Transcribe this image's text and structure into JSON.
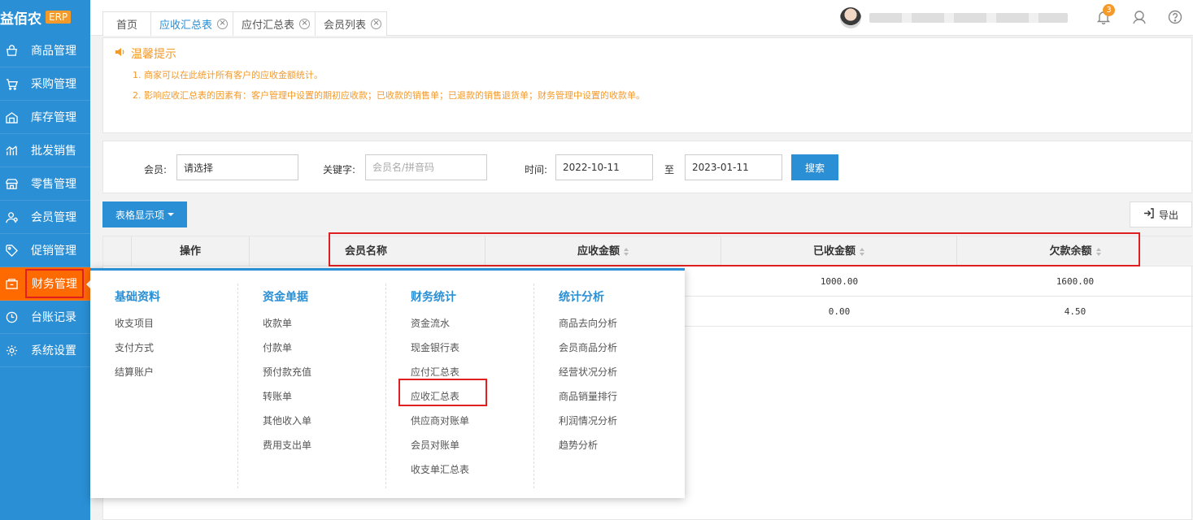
{
  "app": {
    "logo_text": "益佰农",
    "logo_badge": "ERP"
  },
  "sidebar": {
    "items": [
      {
        "label": "商品管理",
        "icon": "bag-icon"
      },
      {
        "label": "采购管理",
        "icon": "cart-icon"
      },
      {
        "label": "库存管理",
        "icon": "warehouse-icon"
      },
      {
        "label": "批发销售",
        "icon": "chart-icon"
      },
      {
        "label": "零售管理",
        "icon": "store-icon"
      },
      {
        "label": "会员管理",
        "icon": "member-icon"
      },
      {
        "label": "促销管理",
        "icon": "tag-icon"
      },
      {
        "label": "财务管理",
        "icon": "finance-icon",
        "active": true
      },
      {
        "label": "台账记录",
        "icon": "record-icon"
      },
      {
        "label": "系统设置",
        "icon": "gear-icon"
      }
    ]
  },
  "tabs": [
    {
      "label": "首页",
      "closable": false
    },
    {
      "label": "应收汇总表",
      "closable": true,
      "active": true
    },
    {
      "label": "应付汇总表",
      "closable": true
    },
    {
      "label": "会员列表",
      "closable": true
    }
  ],
  "header": {
    "notification_count": "3"
  },
  "tips": {
    "title": "温馨提示",
    "line1": "1. 商家可以在此统计所有客户的应收金额统计。",
    "line2": "2. 影响应收汇总表的因素有：客户管理中设置的期初应收款；已收款的销售单；已退款的销售退货单；财务管理中设置的收款单。"
  },
  "search": {
    "member_label": "会员:",
    "member_value": "请选择",
    "keyword_label": "关键字:",
    "keyword_placeholder": "会员名/拼音码",
    "time_label": "时间:",
    "date_from": "2022-10-11",
    "to_label": "至",
    "date_to": "2023-01-11",
    "search_button": "搜索"
  },
  "toolbar": {
    "columns_button": "表格显示项",
    "export_button": "导出"
  },
  "table": {
    "headers": {
      "action": "操作",
      "member_name": "会员名称",
      "receivable": "应收金额",
      "received": "已收金额",
      "balance": "欠款余额"
    },
    "rows": [
      {
        "received": "1000.00",
        "balance": "1600.00"
      },
      {
        "received": "0.00",
        "balance": "4.50"
      }
    ]
  },
  "mega_menu": {
    "columns": [
      {
        "title": "基础资料",
        "items": [
          "收支项目",
          "支付方式",
          "结算账户"
        ]
      },
      {
        "title": "资金单据",
        "items": [
          "收款单",
          "付款单",
          "预付款充值",
          "转账单",
          "其他收入单",
          "费用支出单"
        ]
      },
      {
        "title": "财务统计",
        "items": [
          "资金流水",
          "现金银行表",
          "应付汇总表",
          "应收汇总表",
          "供应商对账单",
          "会员对账单",
          "收支单汇总表"
        ]
      },
      {
        "title": "统计分析",
        "items": [
          "商品去向分析",
          "会员商品分析",
          "经营状况分析",
          "商品销量排行",
          "利润情况分析",
          "趋势分析"
        ]
      }
    ]
  },
  "colors": {
    "primary": "#2a8fd4",
    "active_nav": "#ff6a00",
    "accent": "#f39a2b",
    "highlight": "#e02020"
  }
}
